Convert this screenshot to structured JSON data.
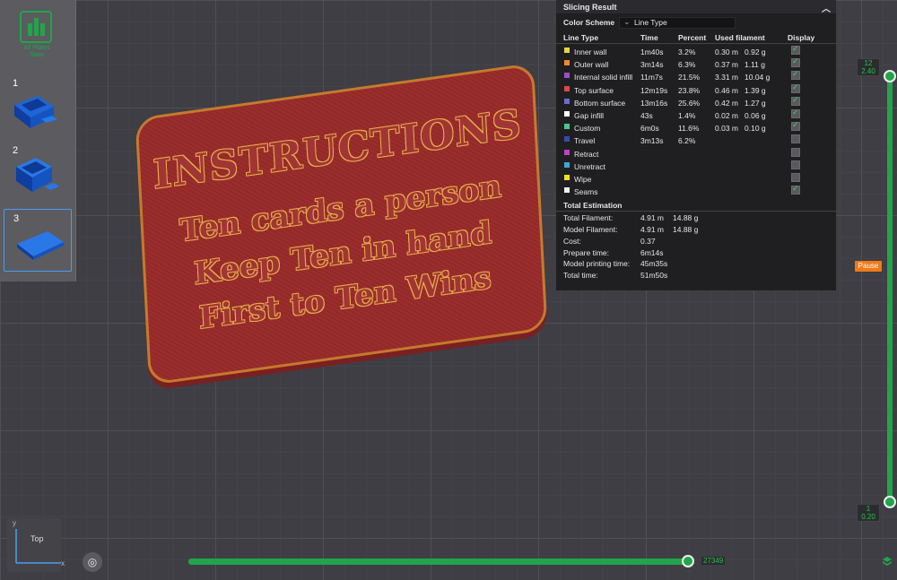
{
  "left_panel": {
    "logo_caption": "All Plates Stats",
    "plates": [
      {
        "num": "1"
      },
      {
        "num": "2"
      },
      {
        "num": "3"
      }
    ]
  },
  "model": {
    "lines": [
      "INSTRUCTIONS",
      "Ten cards a person",
      "Keep Ten in hand",
      "First to Ten Wins"
    ]
  },
  "slicing_result": {
    "title": "Slicing Result",
    "color_scheme_label": "Color Scheme",
    "color_scheme_value": "Line Type",
    "columns": [
      "Line Type",
      "Time",
      "Percent",
      "Used filament",
      "Display"
    ],
    "rows": [
      {
        "name": "Inner wall",
        "time": "1m40s",
        "percent": "3.2%",
        "length": "0.30 m",
        "weight": "0.92 g",
        "color": "#e6d640",
        "display": true
      },
      {
        "name": "Outer wall",
        "time": "3m14s",
        "percent": "6.3%",
        "length": "0.37 m",
        "weight": "1.11 g",
        "color": "#f08a2a",
        "display": true
      },
      {
        "name": "Internal solid infill",
        "time": "11m7s",
        "percent": "21.5%",
        "length": "3.31 m",
        "weight": "10.04 g",
        "color": "#9a4fc4",
        "display": true
      },
      {
        "name": "Top surface",
        "time": "12m19s",
        "percent": "23.8%",
        "length": "0.46 m",
        "weight": "1.39 g",
        "color": "#e0464a",
        "display": true
      },
      {
        "name": "Bottom surface",
        "time": "13m16s",
        "percent": "25.6%",
        "length": "0.42 m",
        "weight": "1.27 g",
        "color": "#6a6ad0",
        "display": true
      },
      {
        "name": "Gap infill",
        "time": "43s",
        "percent": "1.4%",
        "length": "0.02 m",
        "weight": "0.06 g",
        "color": "#ffffff",
        "display": true
      },
      {
        "name": "Custom",
        "time": "6m0s",
        "percent": "11.6%",
        "length": "0.03 m",
        "weight": "0.10 g",
        "color": "#4ec48a",
        "display": true
      },
      {
        "name": "Travel",
        "time": "3m13s",
        "percent": "6.2%",
        "length": "",
        "weight": "",
        "color": "#3a4aa8",
        "display": false
      },
      {
        "name": "Retract",
        "time": "",
        "percent": "",
        "length": "",
        "weight": "",
        "color": "#c040c8",
        "display": false
      },
      {
        "name": "Unretract",
        "time": "",
        "percent": "",
        "length": "",
        "weight": "",
        "color": "#3aa8d8",
        "display": false
      },
      {
        "name": "Wipe",
        "time": "",
        "percent": "",
        "length": "",
        "weight": "",
        "color": "#f0e020",
        "display": false
      },
      {
        "name": "Seams",
        "time": "",
        "percent": "",
        "length": "",
        "weight": "",
        "color": "#f0f0f0",
        "display": true
      }
    ],
    "estimation_title": "Total Estimation",
    "estimation": [
      {
        "label": "Total Filament:",
        "v1": "4.91 m",
        "v2": "14.88 g"
      },
      {
        "label": "Model Filament:",
        "v1": "4.91 m",
        "v2": "14.88 g"
      },
      {
        "label": "Cost:",
        "v1": "0.37",
        "v2": ""
      },
      {
        "label": "Prepare time:",
        "v1": "6m14s",
        "v2": ""
      },
      {
        "label": "Model printing time:",
        "v1": "45m35s",
        "v2": ""
      },
      {
        "label": "Total time:",
        "v1": "51m50s",
        "v2": ""
      }
    ]
  },
  "layer_slider": {
    "top_layer": "12",
    "top_height": "2.40",
    "bottom_layer": "1",
    "bottom_height": "0.20",
    "pause_label": "Pause"
  },
  "move_slider": {
    "value": "27349"
  },
  "view": {
    "label": "Top",
    "axis_y": "y",
    "axis_x": "x"
  },
  "colors": {
    "accent": "#21a44a",
    "pause": "#f07a1a",
    "model": "#9d2d2d"
  }
}
